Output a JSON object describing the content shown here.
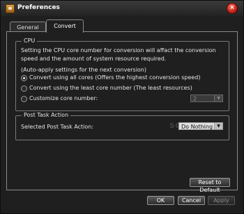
{
  "window": {
    "title": "Preferences",
    "close": "×"
  },
  "tabs": [
    "General",
    "Convert"
  ],
  "cpu": {
    "legend": "CPU",
    "desc_line1": "Setting the CPU core number for conversion will affact the conversion",
    "desc_line2": "speed and the amount of system resource required.",
    "note": "(Auto-apply settings for the next conversion)",
    "options": [
      "Convert using all cores (Offers the highest conversion speed)",
      "Convert using the least core number (The least resources)",
      "Customize core number:"
    ],
    "selected_index": 0,
    "core_value": "2"
  },
  "post_task": {
    "legend": "Post Task Action",
    "label": "Selected Post Task Action:",
    "value": "Do Nothing"
  },
  "watermark": "SOFTPEDIA",
  "buttons": {
    "reset": "Reset to Default",
    "ok": "OK",
    "cancel": "Cancel",
    "apply": "Apply"
  }
}
